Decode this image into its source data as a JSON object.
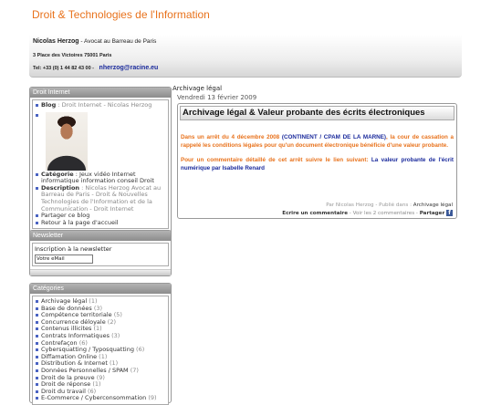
{
  "site": {
    "title": "Droit & Technologies de l'Information"
  },
  "header": {
    "author_name": "Nicolas Herzog",
    "author_role": "- Avocat au Barreau de Paris",
    "address": "3 Place des Victoires 75001 Paris",
    "phone": "Tel: +33 (0) 1 44 82 43 00 -",
    "email": "nherzog@racine.eu"
  },
  "sidebar": {
    "droit_internet": {
      "title": "Droit Internet",
      "blog_label": "Blog",
      "blog_text": ": Droit Internet - Nicolas Herzog",
      "categorie_label": "Catégorie",
      "categorie_text": ": Jeux vidéo Internet informatique information conseil Droit",
      "description_label": "Description",
      "description_text": ": Nicolas Herzog Avocat au Barreau de Paris - Droit & Nouvelles Technologies de l'Information et de la Communication - Droit Internet",
      "share": "Partager ce blog",
      "back": "Retour à la page d'accueil"
    },
    "newsletter": {
      "title": "Newsletter",
      "label": "Inscription à la newsletter",
      "input_value": "Votre eMail"
    },
    "categories": {
      "title": "Catégories",
      "items": [
        {
          "name": "Archivage légal",
          "count": "(1)"
        },
        {
          "name": "Base de données",
          "count": "(3)"
        },
        {
          "name": "Compétence territoriale",
          "count": "(5)"
        },
        {
          "name": "Concurrence déloyale",
          "count": "(2)"
        },
        {
          "name": "Contenus illicites",
          "count": "(1)"
        },
        {
          "name": "Contrats Informatiques",
          "count": "(3)"
        },
        {
          "name": "Contrefaçon",
          "count": "(6)"
        },
        {
          "name": "Cybersquatting / Typosquatting",
          "count": "(6)"
        },
        {
          "name": "Diffamation Online",
          "count": "(1)"
        },
        {
          "name": "Distribution & Internet",
          "count": "(1)"
        },
        {
          "name": "Données Personnelles / SPAM",
          "count": "(7)"
        },
        {
          "name": "Droit de la preuve",
          "count": "(9)"
        },
        {
          "name": "Droit de réponse",
          "count": "(1)"
        },
        {
          "name": "Droit du travail",
          "count": "(6)"
        },
        {
          "name": "E-Commerce / Cyberconsommation",
          "count": "(9)"
        }
      ]
    }
  },
  "main": {
    "breadcrumb": "Archivage légal",
    "post_date": "Vendredi 13 février 2009",
    "post_title": "Archivage légal & Valeur probante des écrits électroniques",
    "p1_a": "Dans un arrêt du 4 décembre 2008",
    "p1_link": "(CONTINENT / CPAM DE LA MARNE)",
    "p1_b": ", la cour de cassation a rappelé les conditions légales pour qu'un document électronique bénéficie d'une valeur probante.",
    "p2_a": "Pour un commentaire détaillé de cet arrêt suivre le lien suivant:",
    "p2_link": "La valeur probante de l'écrit numérique par Isabelle Renard",
    "meta_by": "Par Nicolas Herzog",
    "meta_pub": "- Publié dans :",
    "meta_cat": "Archivage légal",
    "comment_link": "Ecrire un commentaire",
    "comments_count": "- Voir les 2 commentaires -",
    "share_label": "Partager"
  }
}
